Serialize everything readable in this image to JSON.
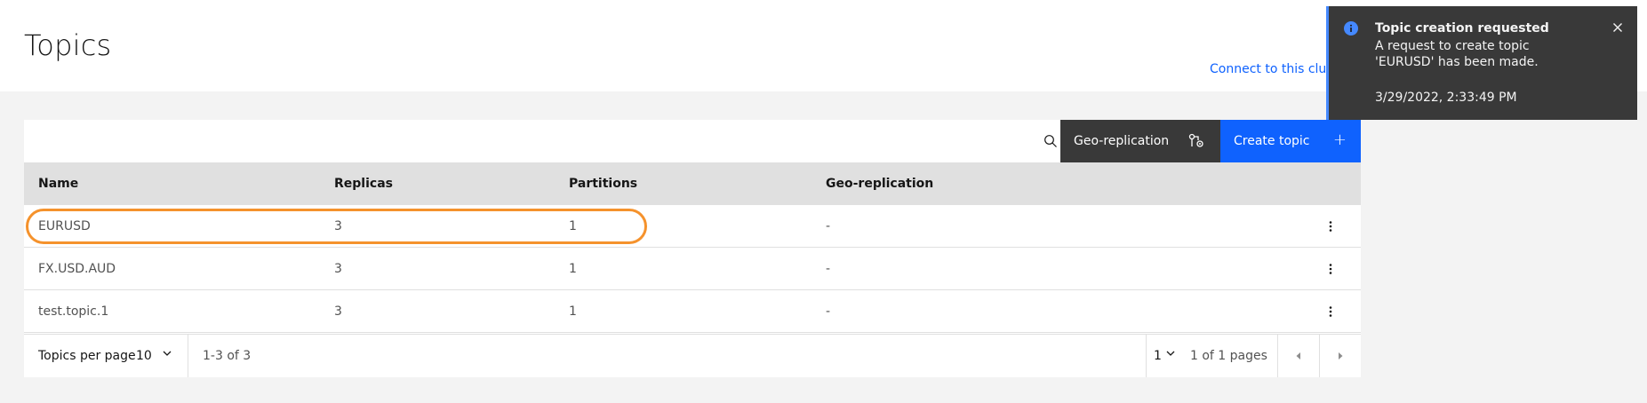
{
  "page": {
    "title": "Topics",
    "connect_link": "Connect to this cluster"
  },
  "toolbar": {
    "search_icon": "search-icon",
    "geo_label": "Geo-replication",
    "geo_icon": "geo-replication-icon",
    "create_label": "Create topic",
    "create_icon": "+"
  },
  "table": {
    "headers": [
      "Name",
      "Replicas",
      "Partitions",
      "Geo-replication"
    ],
    "rows": [
      {
        "name": "EURUSD",
        "replicas": "3",
        "partitions": "1",
        "geo": "-",
        "highlighted": true
      },
      {
        "name": "FX.USD.AUD",
        "replicas": "3",
        "partitions": "1",
        "geo": "-",
        "highlighted": false
      },
      {
        "name": "test.topic.1",
        "replicas": "3",
        "partitions": "1",
        "geo": "-",
        "highlighted": false
      }
    ],
    "overflow_icon": "overflow-menu-icon",
    "highlight_color": "#f5922c"
  },
  "pagination": {
    "per_page_label": "Topics per page",
    "per_page_value": "10",
    "range": "1-3 of 3",
    "current_page": "1",
    "pages_text": "1 of 1 pages"
  },
  "toast": {
    "title": "Topic creation requested",
    "subtitle": "A request to create topic 'EURUSD' has been made.",
    "timestamp": "3/29/2022, 2:33:49 PM",
    "accent": "#4589ff"
  },
  "colors": {
    "primary": "#0f62fe",
    "dark_button": "#393939",
    "header_row": "#e0e0e0"
  }
}
